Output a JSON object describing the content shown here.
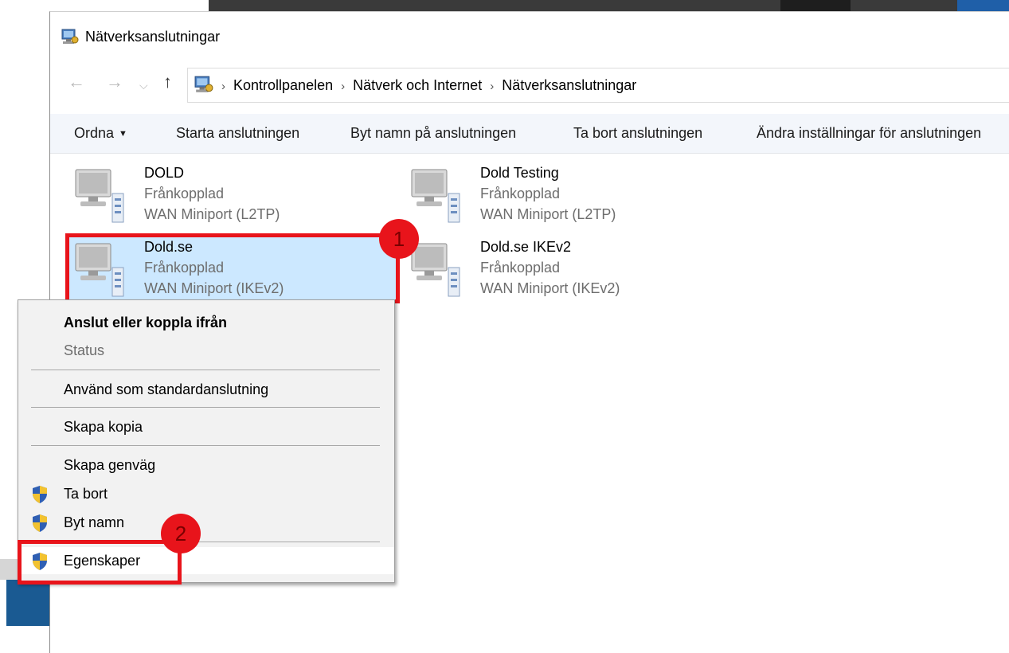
{
  "window": {
    "title": "Nätverksanslutningar",
    "icon": "network-connections-icon"
  },
  "address": {
    "breadcrumbs": [
      "Kontrollpanelen",
      "Nätverk och Internet",
      "Nätverksanslutningar"
    ]
  },
  "toolbar": {
    "organize": "Ordna",
    "start": "Starta anslutningen",
    "rename": "Byt namn på anslutningen",
    "delete": "Ta bort anslutningen",
    "change": "Ändra inställningar för anslutningen"
  },
  "connections": [
    {
      "name": "DOLD",
      "status": "Frånkopplad",
      "device": "WAN Miniport (L2TP)"
    },
    {
      "name": "Dold Testing",
      "status": "Frånkopplad",
      "device": "WAN Miniport (L2TP)"
    },
    {
      "name": "Dold.se",
      "status": "Frånkopplad",
      "device": "WAN Miniport (IKEv2)",
      "selected": true
    },
    {
      "name": "Dold.se IKEv2",
      "status": "Frånkopplad",
      "device": "WAN Miniport (IKEv2)"
    }
  ],
  "context_menu": {
    "items": [
      {
        "label": "Anslut eller koppla ifrån"
      },
      {
        "label": "Status"
      },
      {
        "label": "Använd som standardanslutning"
      },
      {
        "label": "Skapa kopia"
      },
      {
        "label": "Skapa genväg"
      },
      {
        "label": "Ta bort"
      },
      {
        "label": "Byt namn"
      },
      {
        "label": "Egenskaper"
      }
    ]
  },
  "annotations": {
    "badge1": "1",
    "badge2": "2",
    "color": "#e8141b"
  },
  "colors": {
    "selection": "#cce8ff",
    "toolbar_bg": "#f3f6fb",
    "menu_bg": "#f2f2f2"
  }
}
